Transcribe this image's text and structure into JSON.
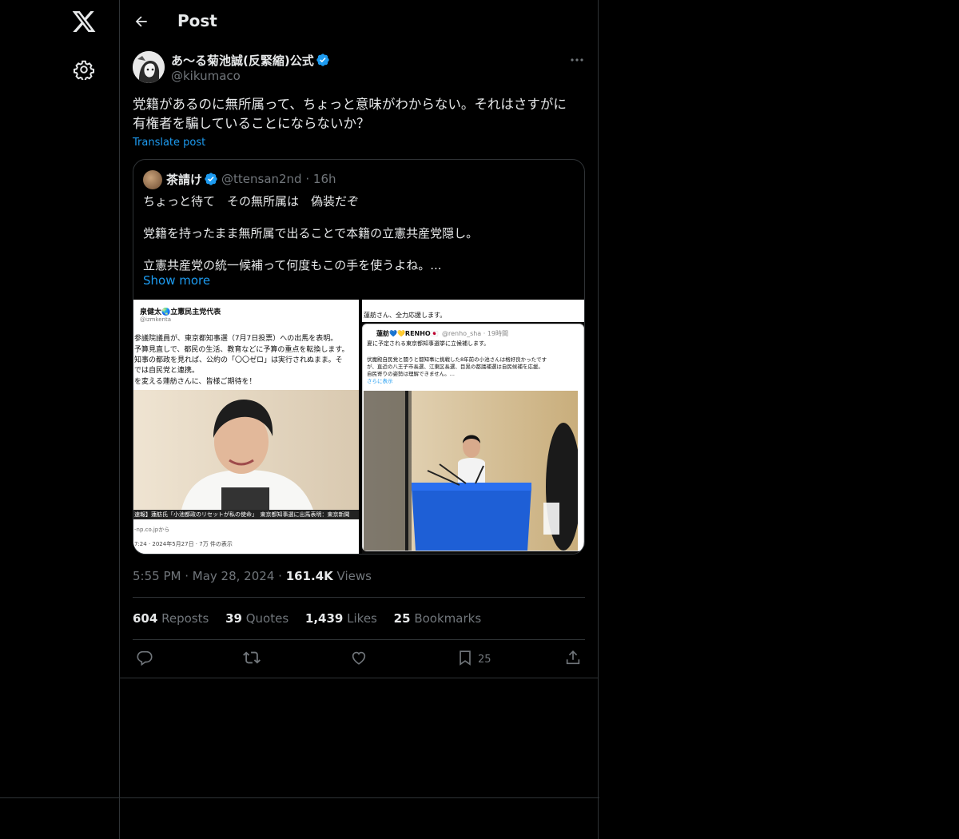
{
  "nav": {
    "logo_icon": "x-logo-icon",
    "settings_icon": "gear-icon"
  },
  "header": {
    "back_icon": "arrow-left-icon",
    "title": "Post"
  },
  "post": {
    "author_name": "あ〜る菊池誠(反緊縮)公式",
    "author_handle": "@kikumaco",
    "verified": true,
    "more_icon": "ellipsis-icon",
    "text_line1": "党籍があるのに無所属って、ちょっと意味がわからない。それはさすがに",
    "text_line2": "有権者を騙していることにならないか？",
    "translate_label": "Translate post",
    "time": "5:55 PM",
    "date": "May 28, 2024",
    "views_count": "161.4K",
    "views_label": "Views",
    "stats": {
      "reposts_count": "604",
      "reposts_label": "Reposts",
      "quotes_count": "39",
      "quotes_label": "Quotes",
      "likes_count": "1,439",
      "likes_label": "Likes",
      "bookmarks_count": "25",
      "bookmarks_label": "Bookmarks"
    },
    "actions": {
      "reply_icon": "reply-icon",
      "repost_icon": "repost-icon",
      "like_icon": "heart-icon",
      "bookmark_icon": "bookmark-icon",
      "bookmark_count": "25",
      "share_icon": "share-icon"
    }
  },
  "quote": {
    "author_name": "茶請け",
    "author_handle": "@ttensan2nd",
    "age": "16h",
    "line1": "ちょっと待て　その無所属は　偽装だぞ",
    "line2": "党籍を持ったまま無所属で出ることで本籍の立憲共産党隠し。",
    "line3": "立憲共産党の統一候補って何度もこの手を使うよね。...",
    "show_more": "Show more",
    "img_left": {
      "name": "泉健太🌏立憲民主党代表",
      "handle": "@izmkenta",
      "l1": "参議院議員が、東京都知事選（7月7日投票）への出馬を表明。",
      "l2": "予算見直しで、都民の生活、教育などに予算の重点を転換します。",
      "l3": "知事の都政を見れば、公約の「〇〇ゼロ」は実行されぬまま。そ",
      "l4": "では自民党と連携。",
      "l5": "を変える蓮舫さんに、皆様ご期待を！",
      "caption": "速報】蓮舫氏「小池都政のリセットが私の使命」　東京都知事選に出馬表明：東京新聞",
      "source": "-np.co.jpから",
      "foot": "7:24 · 2024年5月27日 · 7万 件の表示"
    },
    "img_right": {
      "top": "蓮舫さん、全力応援します。",
      "name": "蓮舫💙💛RENHO🇯🇵",
      "handle": "@renho_sha · 19時間",
      "l1": "夏に予定される東京都知事選挙に立候補します。",
      "l2": "伏魔殿自民党と闘うと都知事に挑戦した8年前の小池さんは格好良かったです",
      "l3": "が、直近の八王子市長選、江東区長選、目黒の都議補選は自民候補を応援。",
      "l4": "自民寄りの姿勢は理解できません。...",
      "l5": "さらに表示"
    }
  },
  "colors": {
    "background": "#000000",
    "text": "#e7e9ea",
    "muted": "#71767b",
    "accent": "#1d9bf0",
    "border": "#2f3336"
  }
}
